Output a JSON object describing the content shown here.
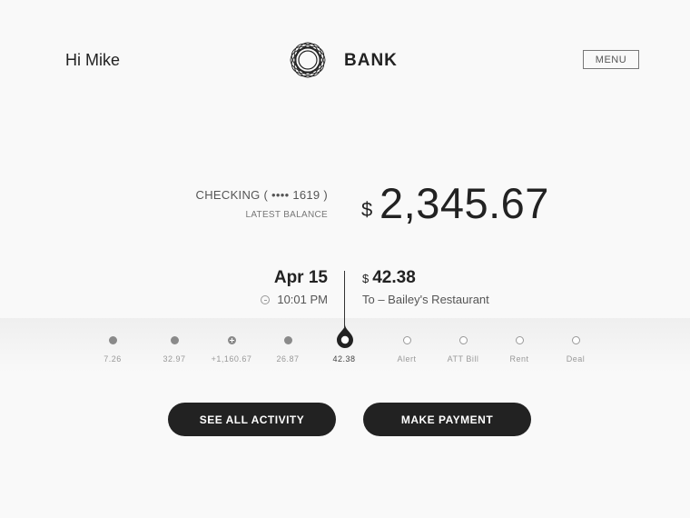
{
  "header": {
    "greeting": "Hi Mike",
    "brand": "BANK",
    "menu_label": "MENU",
    "logo_icon": "spirograph-ring-logo"
  },
  "account": {
    "label": "CHECKING ( •••• 1619 )",
    "sublabel": "LATEST BALANCE",
    "currency": "$",
    "balance": "2,345.67"
  },
  "transaction": {
    "date": "Apr 15",
    "time": "10:01 PM",
    "time_icon": "clock-icon",
    "currency": "$",
    "amount": "42.38",
    "description": "To – Bailey's Restaurant"
  },
  "timeline": {
    "items": [
      {
        "label": "7.26",
        "marker": "filled"
      },
      {
        "label": "32.97",
        "marker": "filled"
      },
      {
        "label": "+1,160.67",
        "marker": "plus"
      },
      {
        "label": "26.87",
        "marker": "filled"
      },
      {
        "label": "42.38",
        "marker": "selected"
      },
      {
        "label": "Alert",
        "marker": "hollow"
      },
      {
        "label": "ATT Bill",
        "marker": "hollow"
      },
      {
        "label": "Rent",
        "marker": "hollow"
      },
      {
        "label": "Deal",
        "marker": "hollow"
      }
    ]
  },
  "actions": {
    "see_all_label": "SEE ALL ACTIVITY",
    "payment_label": "MAKE PAYMENT"
  },
  "colors": {
    "background": "#f9f9f9",
    "button": "#222222",
    "text": "#222222"
  }
}
